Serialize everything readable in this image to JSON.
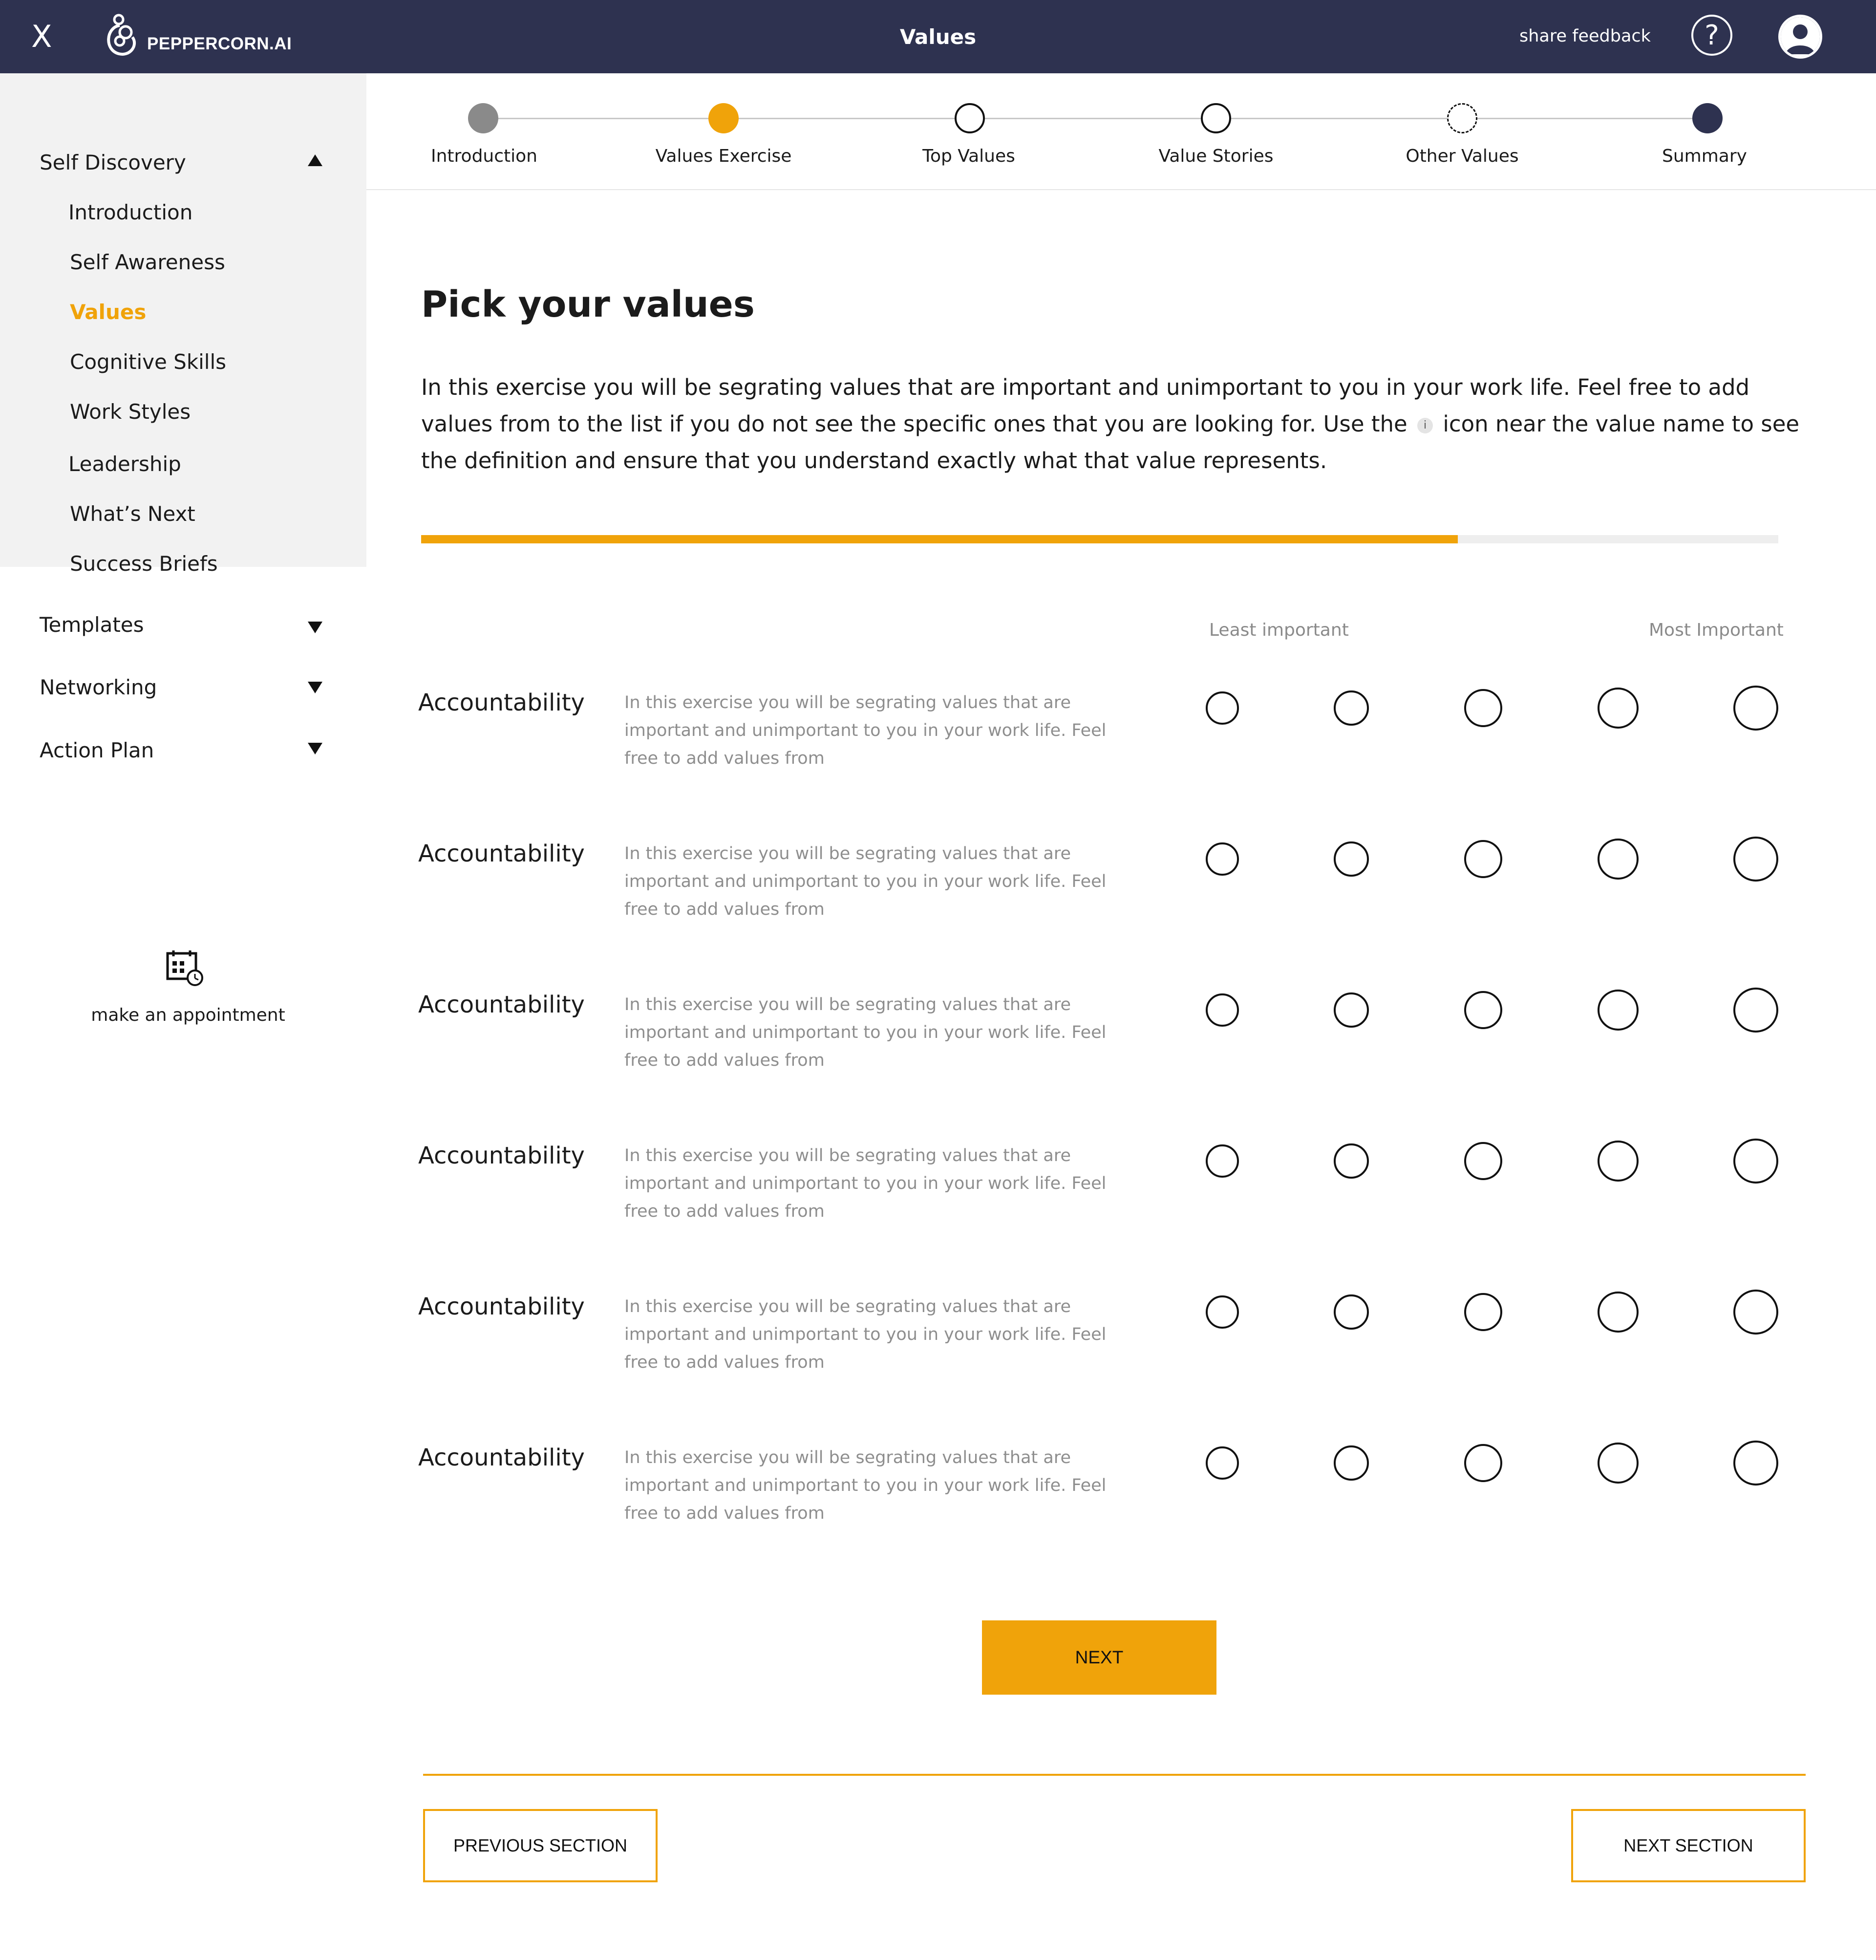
{
  "header": {
    "close_label": "X",
    "brand": "PEPPERCORN.AI",
    "title": "Values",
    "share_feedback": "share feedback",
    "help_label": "?"
  },
  "sidebar": {
    "sections": [
      {
        "label": "Self Discovery",
        "expanded": true
      },
      {
        "label": "Templates",
        "expanded": false
      },
      {
        "label": "Networking",
        "expanded": false
      },
      {
        "label": "Action Plan",
        "expanded": false
      }
    ],
    "items": [
      {
        "label": "Introduction"
      },
      {
        "label": "Self Awareness"
      },
      {
        "label": "Values",
        "active": true
      },
      {
        "label": "Cognitive Skills"
      },
      {
        "label": "Work Styles"
      },
      {
        "label": "Leadership"
      },
      {
        "label": "What’s Next"
      },
      {
        "label": "Success Briefs"
      }
    ],
    "appointment_label": "make an appointment"
  },
  "stepper": {
    "steps": [
      {
        "label": "Introduction",
        "state": "completed"
      },
      {
        "label": "Values Exercise",
        "state": "current"
      },
      {
        "label": "Top Values",
        "state": "upcoming"
      },
      {
        "label": "Value Stories",
        "state": "upcoming"
      },
      {
        "label": "Other Values",
        "state": "optional"
      },
      {
        "label": "Summary",
        "state": "final"
      }
    ]
  },
  "main": {
    "heading": "Pick your values",
    "intro_part1": "In this exercise you will be segrating values that are important and unimportant to you in your work life. Feel free to add values from to the list if you do not see the specific ones that you are looking for. Use the",
    "intro_icon": "i",
    "intro_part2": "icon near the value name to see the definition and ensure that you understand exactly what that value represents.",
    "progress_fraction": 0.764,
    "scale_least": "Least important",
    "scale_most": "Most Important",
    "values": [
      {
        "name": "Accountability",
        "description": "In this exercise you will be segrating values that are important and unimportant to you in your work life. Feel free to add values from"
      },
      {
        "name": "Accountability",
        "description": "In this exercise you will be segrating values that are important and unimportant to you in your work life. Feel free to add values from"
      },
      {
        "name": "Accountability",
        "description": "In this exercise you will be segrating values that are important and unimportant to you in your work life. Feel free to add values from"
      },
      {
        "name": "Accountability",
        "description": "In this exercise you will be segrating values that are important and unimportant to you in your work life. Feel free to add values from"
      },
      {
        "name": "Accountability",
        "description": "In this exercise you will be segrating values that are important and unimportant to you in your work life. Feel free to add values from"
      },
      {
        "name": "Accountability",
        "description": "In this exercise you will be segrating values that are important and unimportant to you in your work life. Feel free to add values from"
      }
    ],
    "next_button": "NEXT",
    "previous_section": "PREVIOUS SECTION",
    "next_section": "NEXT SECTION"
  },
  "colors": {
    "header_bg": "#2e3250",
    "accent": "#f0a30a",
    "sidebar_bg": "#f2f2f2",
    "completed_step": "#8a8a8a"
  },
  "icons": [
    "close-icon",
    "peppercorn-logo",
    "help-icon",
    "user-avatar-icon",
    "chevron-up-icon",
    "chevron-down-icon",
    "calendar-clock-icon",
    "info-icon"
  ]
}
